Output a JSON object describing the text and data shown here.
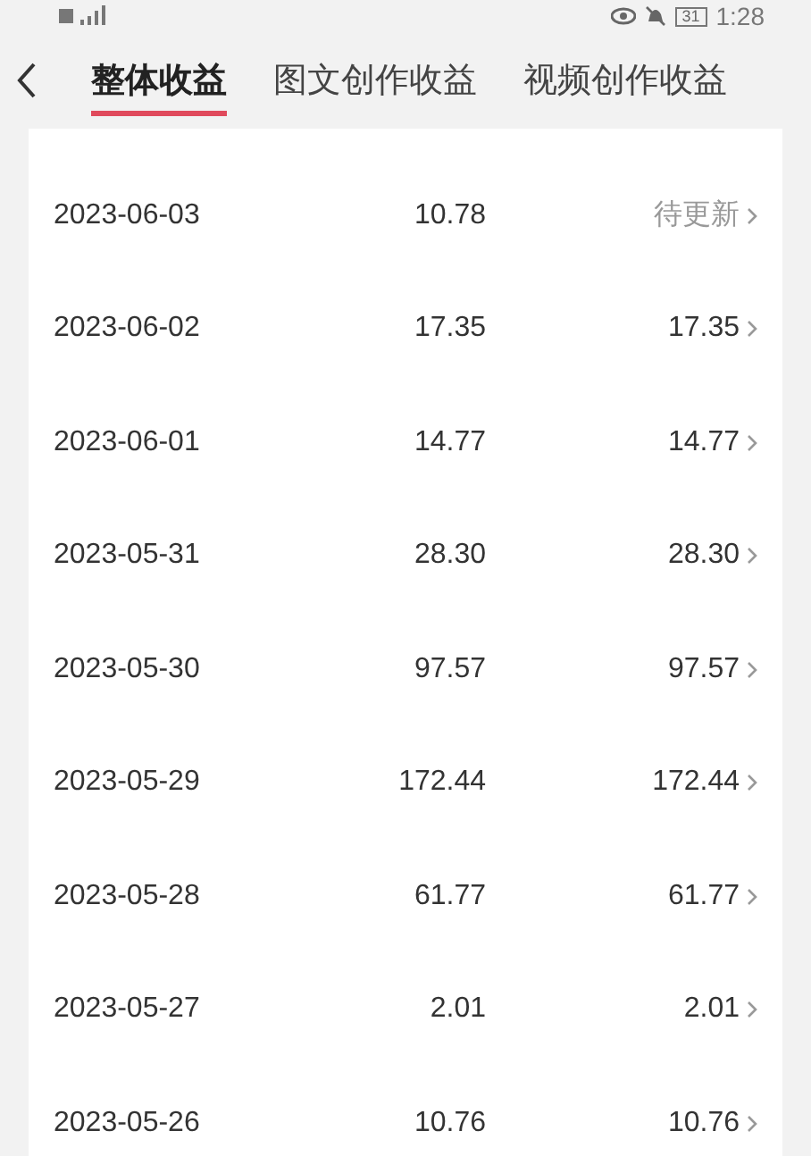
{
  "status_bar": {
    "battery": "31",
    "time": "1:28"
  },
  "tabs": [
    {
      "label": "整体收益",
      "selected": true
    },
    {
      "label": "图文创作收益",
      "selected": false
    },
    {
      "label": "视频创作收益",
      "selected": false
    }
  ],
  "rows": [
    {
      "date": "2023-06-03",
      "amount": "10.78",
      "settled": "待更新"
    },
    {
      "date": "2023-06-02",
      "amount": "17.35",
      "settled": "17.35"
    },
    {
      "date": "2023-06-01",
      "amount": "14.77",
      "settled": "14.77"
    },
    {
      "date": "2023-05-31",
      "amount": "28.30",
      "settled": "28.30"
    },
    {
      "date": "2023-05-30",
      "amount": "97.57",
      "settled": "97.57"
    },
    {
      "date": "2023-05-29",
      "amount": "172.44",
      "settled": "172.44"
    },
    {
      "date": "2023-05-28",
      "amount": "61.77",
      "settled": "61.77"
    },
    {
      "date": "2023-05-27",
      "amount": "2.01",
      "settled": "2.01"
    },
    {
      "date": "2023-05-26",
      "amount": "10.76",
      "settled": "10.76"
    }
  ]
}
